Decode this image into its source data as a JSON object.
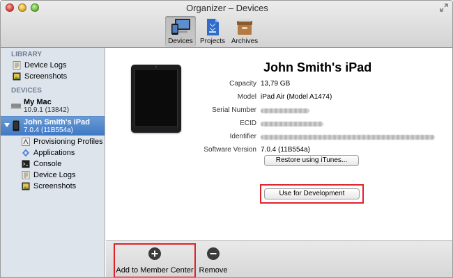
{
  "window": {
    "title": "Organizer – Devices"
  },
  "toolbar": {
    "items": [
      {
        "label": "Devices",
        "icon": "devices-icon",
        "active": true
      },
      {
        "label": "Projects",
        "icon": "projects-icon",
        "active": false
      },
      {
        "label": "Archives",
        "icon": "archives-icon",
        "active": false
      }
    ]
  },
  "sidebar": {
    "library_header": "LIBRARY",
    "library_items": [
      {
        "label": "Device Logs",
        "icon": "device-logs-icon"
      },
      {
        "label": "Screenshots",
        "icon": "screenshots-icon"
      }
    ],
    "devices_header": "DEVICES",
    "devices": [
      {
        "name": "My Mac",
        "subtitle": "10.9.1 (13842)",
        "icon": "mac-icon",
        "selected": false
      },
      {
        "name": "John Smith's iPad",
        "subtitle": "7.0.4 (11B554a)",
        "icon": "ipad-icon",
        "selected": true
      }
    ],
    "device_items": [
      {
        "label": "Provisioning Profiles",
        "icon": "provisioning-profiles-icon"
      },
      {
        "label": "Applications",
        "icon": "applications-icon"
      },
      {
        "label": "Console",
        "icon": "console-icon"
      },
      {
        "label": "Device Logs",
        "icon": "device-logs-icon"
      },
      {
        "label": "Screenshots",
        "icon": "screenshots-icon"
      }
    ]
  },
  "device": {
    "name": "John Smith's iPad",
    "fields": [
      {
        "key": "Capacity",
        "value": "13,79 GB",
        "blurred": false
      },
      {
        "key": "Model",
        "value": "iPad Air (Model A1474)",
        "blurred": false
      },
      {
        "key": "Serial Number",
        "value": "",
        "blurred": true
      },
      {
        "key": "ECID",
        "value": "",
        "blurred": true
      },
      {
        "key": "Identifier",
        "value": "",
        "blurred": true
      },
      {
        "key": "Software Version",
        "value": "7.0.4 (11B554a)",
        "blurred": false
      }
    ],
    "restore_button": "Restore using iTunes...",
    "use_for_dev_button": "Use for Development"
  },
  "bottombar": {
    "add_label": "Add to Member Center",
    "remove_label": "Remove"
  },
  "colors": {
    "highlight": "#e0212a",
    "selection": "#4a82c9",
    "sidebar_bg": "#dde4ec"
  }
}
